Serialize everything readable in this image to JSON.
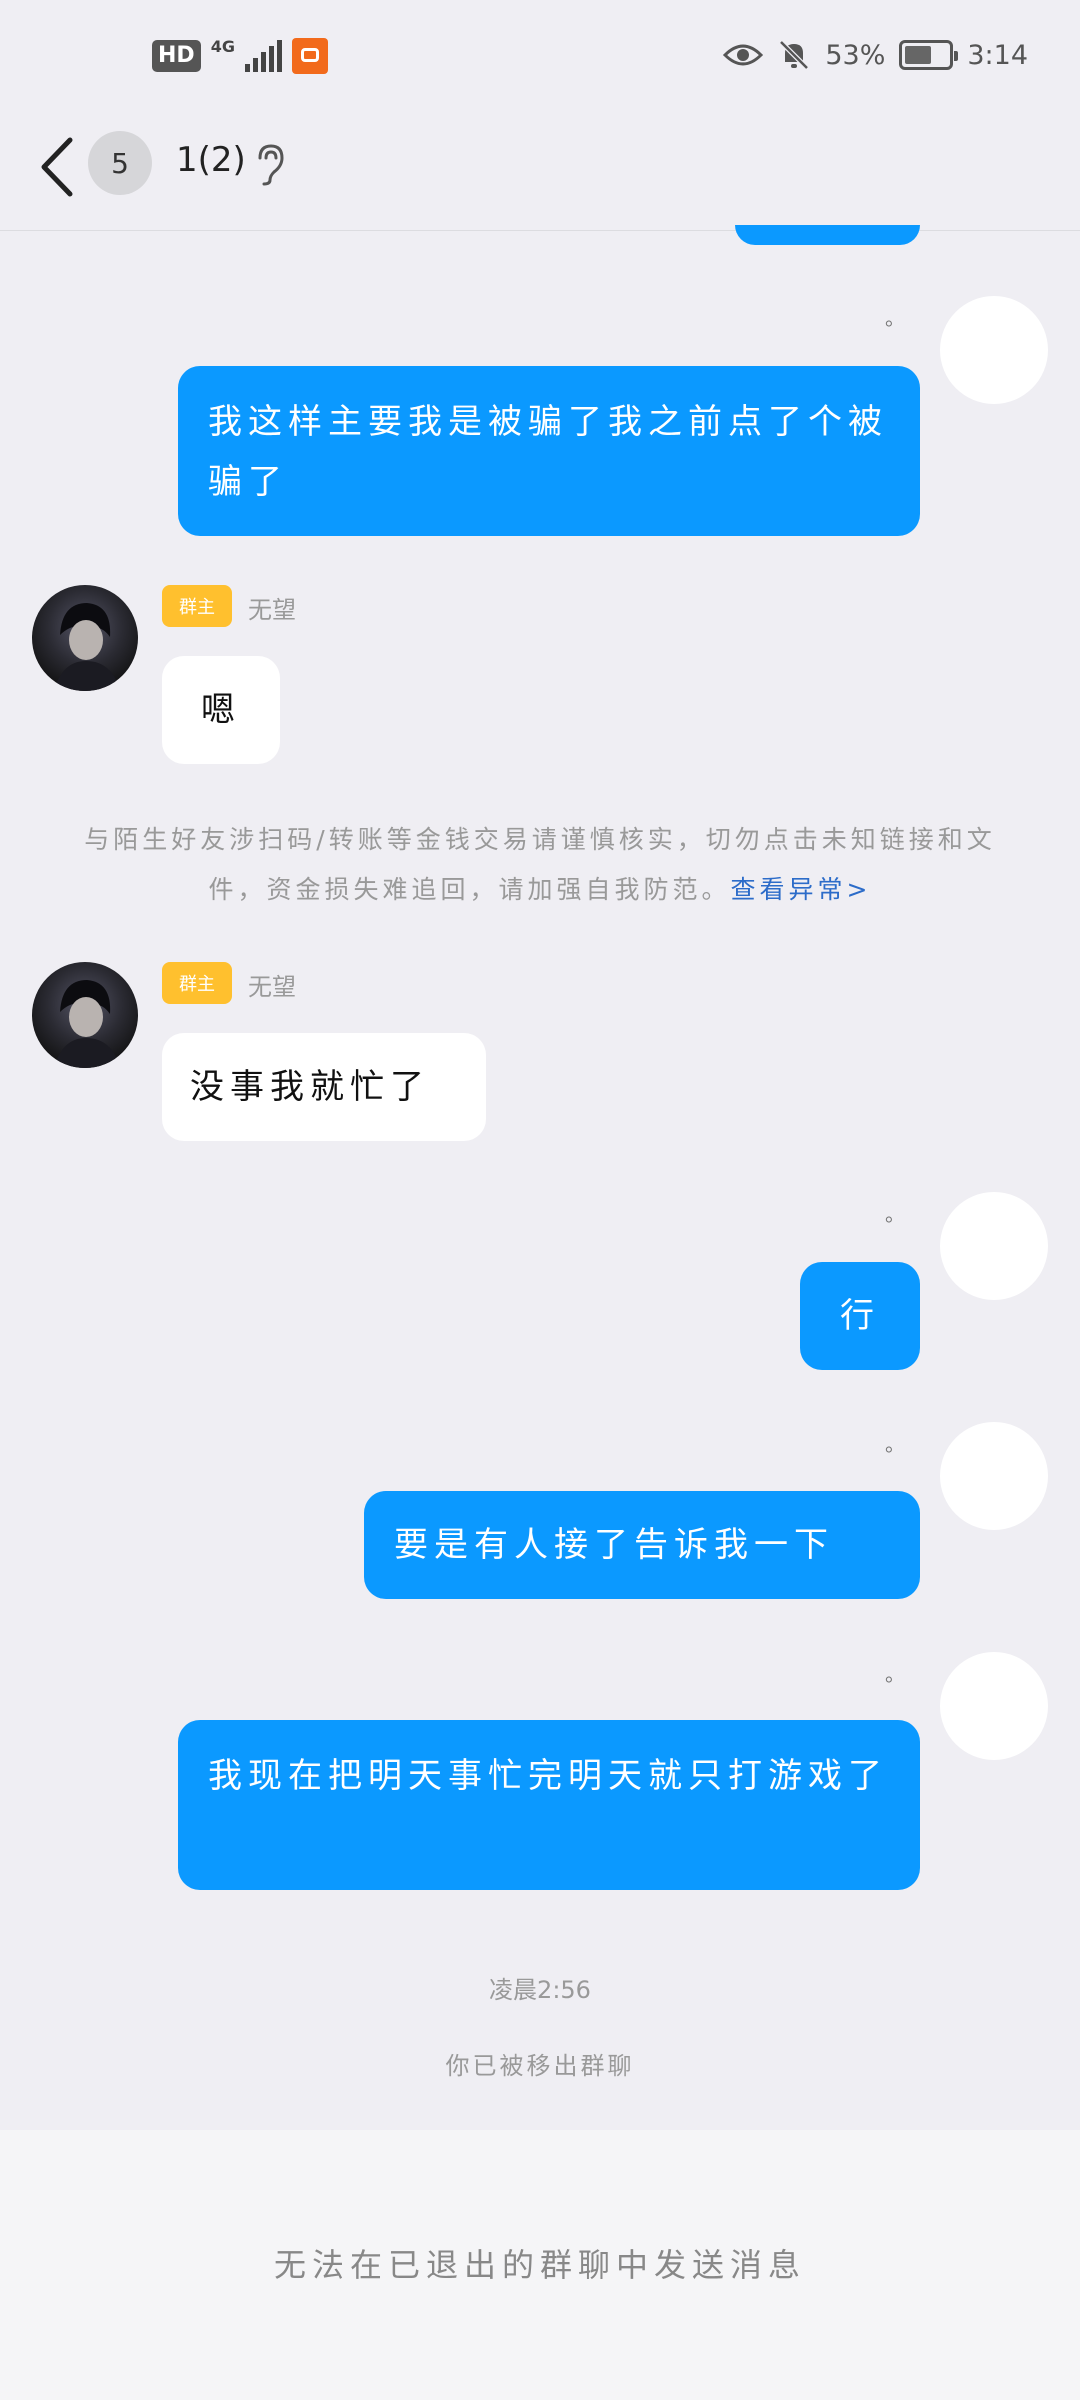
{
  "status_bar": {
    "hd": "HD",
    "network": "4G",
    "battery_percent": "53%",
    "time": "3:14"
  },
  "header": {
    "unread_count": "5",
    "title": "1(2)"
  },
  "messages": [
    {
      "side": "out",
      "text": "我这样主要我是被骗了我之前点了个被骗了"
    },
    {
      "side": "in",
      "tag": "群主",
      "sender": "无望",
      "text": "嗯"
    },
    {
      "side": "in",
      "tag": "群主",
      "sender": "无望",
      "text": "没事我就忙了"
    },
    {
      "side": "out",
      "text": "行"
    },
    {
      "side": "out",
      "text": "要是有人接了告诉我一下"
    },
    {
      "side": "out",
      "text": "我现在把明天事忙完明天就只打游戏了"
    }
  ],
  "dot": "。",
  "notice": {
    "text": "与陌生好友涉扫码/转账等金钱交易请谨慎核实，切勿点击未知链接和文件，资金损失难追回，请加强自我防范。",
    "link": "查看异常>"
  },
  "timestamp": "凌晨2:56",
  "system_message": "你已被移出群聊",
  "footer": {
    "text": "无法在已退出的群聊中发送消息"
  },
  "colors": {
    "outgoing_bubble": "#0b99ff",
    "owner_tag": "#ffc02e",
    "link": "#2c6cc9"
  }
}
